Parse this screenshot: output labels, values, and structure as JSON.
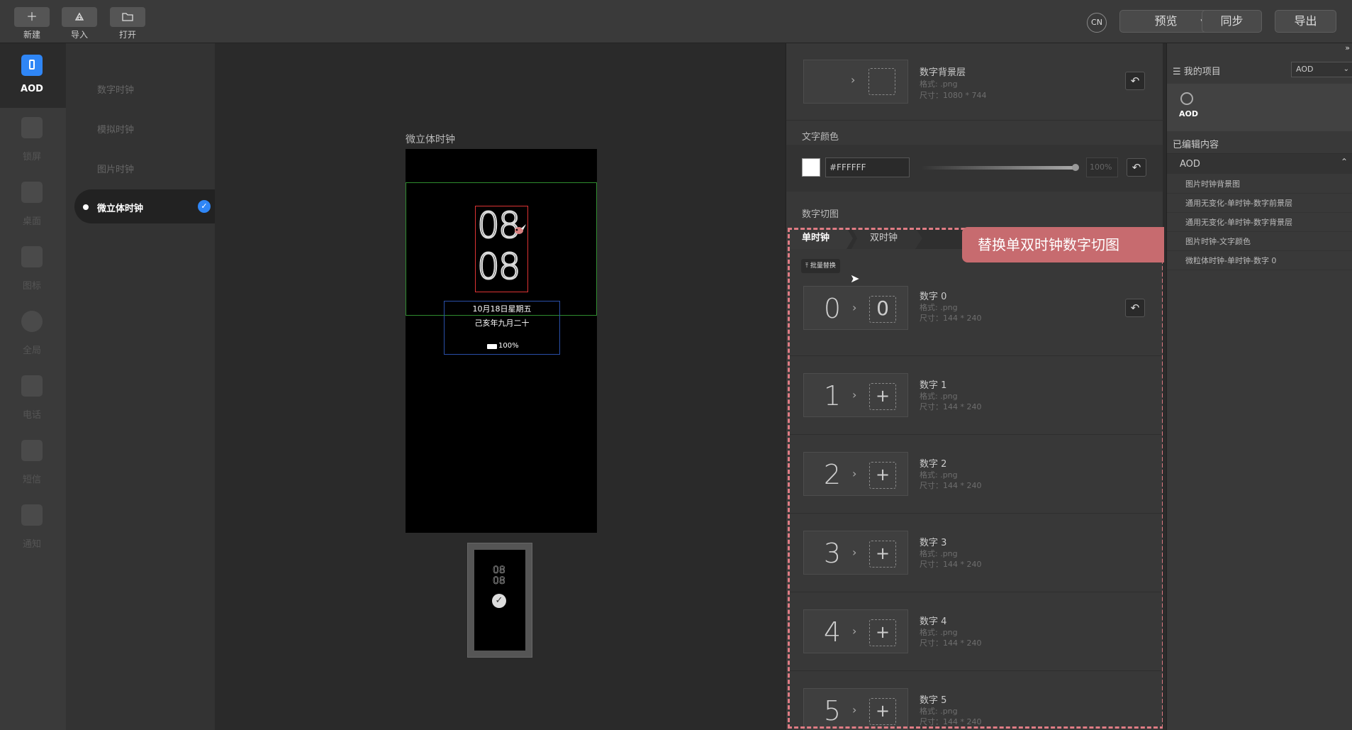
{
  "toolbar": {
    "new_label": "新建",
    "import_label": "导入",
    "open_label": "打开",
    "lang": "CN",
    "preview_label": "预览",
    "sync_label": "同步",
    "export_label": "导出"
  },
  "iconbar": {
    "items": [
      {
        "label": "AOD",
        "icon": "phone-icon"
      },
      {
        "label": "锁屏",
        "icon": "lock-icon"
      },
      {
        "label": "桌面",
        "icon": "desktop-icon"
      },
      {
        "label": "图标",
        "icon": "grid-icon"
      },
      {
        "label": "全局",
        "icon": "gear-icon"
      },
      {
        "label": "电话",
        "icon": "phone-call-icon"
      },
      {
        "label": "短信",
        "icon": "message-icon"
      },
      {
        "label": "通知",
        "icon": "bell-icon"
      }
    ]
  },
  "submenu": {
    "items": [
      "数字时钟",
      "模拟时钟",
      "图片时钟",
      "微立体时钟"
    ],
    "active_index": 3
  },
  "canvas": {
    "title": "微立体时钟",
    "clock_hours": "08",
    "clock_minutes": "08",
    "date_line": "10月18日星期五",
    "lunar_line": "己亥年九月二十",
    "battery": "100%"
  },
  "props": {
    "bg_layer": {
      "title": "数字背景层",
      "format": "格式: .png",
      "size": "尺寸：1080 * 744"
    },
    "text_color_section": "文字颜色",
    "text_color_value": "#FFFFFF",
    "opacity": "100%",
    "digit_section": "数字切图",
    "tabs": [
      "单时钟",
      "双时钟"
    ],
    "batch_replace": "批量替换",
    "callout": "替换单双时钟数字切图",
    "digits": [
      {
        "digit": "0",
        "title": "数字 0",
        "format": "格式: .png",
        "size": "尺寸：144 * 240"
      },
      {
        "digit": "1",
        "title": "数字 1",
        "format": "格式: .png",
        "size": "尺寸：144 * 240"
      },
      {
        "digit": "2",
        "title": "数字 2",
        "format": "格式: .png",
        "size": "尺寸：144 * 240"
      },
      {
        "digit": "3",
        "title": "数字 3",
        "format": "格式: .png",
        "size": "尺寸：144 * 240"
      },
      {
        "digit": "4",
        "title": "数字 4",
        "format": "格式: .png",
        "size": "尺寸：144 * 240"
      },
      {
        "digit": "5",
        "title": "数字 5",
        "format": "格式: .png",
        "size": "尺寸：144 * 240"
      }
    ]
  },
  "project": {
    "header": "我的项目",
    "select_value": "AOD",
    "item_label": "AOD",
    "edited_title": "已编辑内容",
    "group": "AOD",
    "edited_items": [
      "图片时钟背景图",
      "通用无变化-单时钟-数字前景层",
      "通用无变化-单时钟-数字背景层",
      "图片时钟-文字颜色",
      "微粒体时钟-单时钟-数字 0"
    ]
  },
  "colors": {
    "accent": "#2f86f6",
    "callout_bg": "#c76b6f",
    "dashed_border": "#e07c84"
  }
}
